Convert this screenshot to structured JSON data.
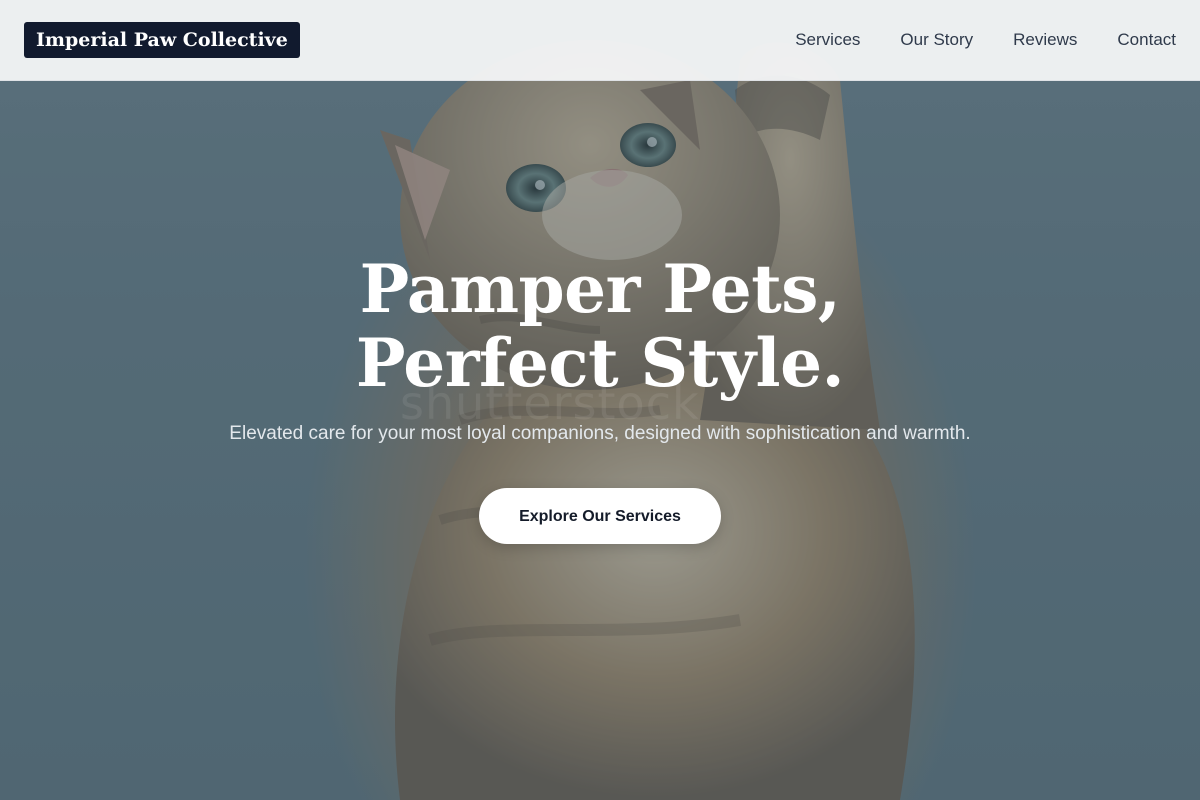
{
  "header": {
    "brand": "Imperial Paw Collective",
    "nav": [
      {
        "label": "Services"
      },
      {
        "label": "Our Story"
      },
      {
        "label": "Reviews"
      },
      {
        "label": "Contact"
      }
    ]
  },
  "hero": {
    "title": "Pamper Pets, Perfect Style.",
    "subtitle": "Elevated care for your most loyal companions, designed with sophistication and warmth.",
    "cta_label": "Explore Our Services",
    "watermark": "shutterstock"
  },
  "colors": {
    "brand_bg": "#111a2e",
    "header_bg": "#f4f5f7",
    "nav_text": "#2f3a4b",
    "hero_overlay": "#374b5a",
    "cta_bg": "#ffffff",
    "cta_text": "#141b29"
  }
}
